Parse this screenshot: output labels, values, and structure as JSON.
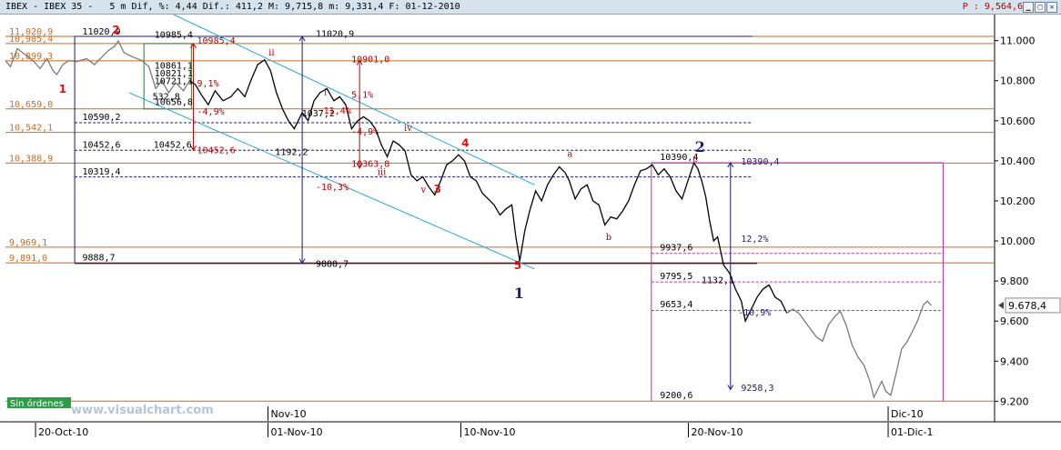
{
  "title_bar": {
    "text": "IBEX - IBEX 35 -   5 m Dif, %: 4,44 Dif.: 411,2 M: 9,715,8 m: 9,331,4 F: 01-12-2010",
    "close_text": "P : 9,564,6",
    "buttons": [
      "minimize",
      "maximize",
      "close"
    ]
  },
  "colors": {
    "background": "#ffffff",
    "price_dark": "#000000",
    "price_light": "#7a7a7a",
    "horizontal_level": "#d2691e",
    "channel": "#2aa8d8",
    "navy": "#1c1c7a",
    "magenta": "#c030a0",
    "red": "#c00000",
    "green_box": "#2e7d32",
    "watermark": "#b8c4d8"
  },
  "chart_data": {
    "type": "line",
    "symbol": "IBEX 35",
    "interval": "5 m",
    "ylim": [
      9120,
      11130
    ],
    "y_ticks": [
      "11.000",
      "10.800",
      "10.600",
      "10.400",
      "10.200",
      "10.000",
      "9.800",
      "9.600",
      "9.400",
      "9.200"
    ],
    "last_price": "9.678,4",
    "x_labels": [
      {
        "label": "20-Oct-10",
        "pos": 0.035
      },
      {
        "label": "Nov-10",
        "pos": 0.27,
        "tier": "month"
      },
      {
        "label": "01-Nov-10",
        "pos": 0.27
      },
      {
        "label": "10-Nov-10",
        "pos": 0.465
      },
      {
        "label": "20-Nov-10",
        "pos": 0.695
      },
      {
        "label": "Dic-10",
        "pos": 0.897,
        "tier": "month"
      },
      {
        "label": "01-Dic-1",
        "pos": 0.897
      }
    ],
    "price_series": [
      [
        0.0,
        10900
      ],
      [
        0.005,
        10870
      ],
      [
        0.012,
        10960
      ],
      [
        0.02,
        10930
      ],
      [
        0.028,
        10900
      ],
      [
        0.035,
        10860
      ],
      [
        0.042,
        10910
      ],
      [
        0.048,
        10850
      ],
      [
        0.052,
        10830
      ],
      [
        0.058,
        10880
      ],
      [
        0.064,
        10900
      ],
      [
        0.072,
        10895
      ],
      [
        0.082,
        10910
      ],
      [
        0.09,
        10880
      ],
      [
        0.098,
        10920
      ],
      [
        0.104,
        10950
      ],
      [
        0.11,
        10970
      ],
      [
        0.114,
        10998
      ],
      [
        0.12,
        10940
      ],
      [
        0.128,
        10920
      ],
      [
        0.138,
        10900
      ],
      [
        0.145,
        10870
      ],
      [
        0.152,
        10760
      ],
      [
        0.158,
        10800
      ],
      [
        0.165,
        10740
      ],
      [
        0.172,
        10790
      ],
      [
        0.18,
        10750
      ],
      [
        0.186,
        10800
      ],
      [
        0.192,
        10780
      ],
      [
        0.198,
        10730
      ],
      [
        0.205,
        10680
      ],
      [
        0.212,
        10750
      ],
      [
        0.22,
        10700
      ],
      [
        0.228,
        10720
      ],
      [
        0.235,
        10760
      ],
      [
        0.242,
        10720
      ],
      [
        0.248,
        10800
      ],
      [
        0.255,
        10880
      ],
      [
        0.262,
        10904
      ],
      [
        0.268,
        10850
      ],
      [
        0.274,
        10740
      ],
      [
        0.28,
        10660
      ],
      [
        0.286,
        10600
      ],
      [
        0.292,
        10560
      ],
      [
        0.3,
        10640
      ],
      [
        0.306,
        10600
      ],
      [
        0.312,
        10700
      ],
      [
        0.318,
        10740
      ],
      [
        0.325,
        10760
      ],
      [
        0.332,
        10700
      ],
      [
        0.338,
        10720
      ],
      [
        0.344,
        10680
      ],
      [
        0.35,
        10560
      ],
      [
        0.356,
        10600
      ],
      [
        0.362,
        10620
      ],
      [
        0.368,
        10600
      ],
      [
        0.374,
        10560
      ],
      [
        0.38,
        10480
      ],
      [
        0.386,
        10420
      ],
      [
        0.392,
        10500
      ],
      [
        0.398,
        10480
      ],
      [
        0.404,
        10450
      ],
      [
        0.41,
        10330
      ],
      [
        0.416,
        10300
      ],
      [
        0.422,
        10320
      ],
      [
        0.428,
        10270
      ],
      [
        0.434,
        10230
      ],
      [
        0.44,
        10300
      ],
      [
        0.446,
        10380
      ],
      [
        0.452,
        10400
      ],
      [
        0.458,
        10430
      ],
      [
        0.464,
        10400
      ],
      [
        0.47,
        10320
      ],
      [
        0.476,
        10300
      ],
      [
        0.482,
        10240
      ],
      [
        0.488,
        10210
      ],
      [
        0.494,
        10180
      ],
      [
        0.5,
        10130
      ],
      [
        0.506,
        10160
      ],
      [
        0.512,
        10180
      ],
      [
        0.516,
        10020
      ],
      [
        0.52,
        9900
      ],
      [
        0.525,
        10050
      ],
      [
        0.53,
        10150
      ],
      [
        0.536,
        10250
      ],
      [
        0.542,
        10200
      ],
      [
        0.548,
        10280
      ],
      [
        0.554,
        10330
      ],
      [
        0.56,
        10370
      ],
      [
        0.566,
        10340
      ],
      [
        0.57,
        10300
      ],
      [
        0.576,
        10210
      ],
      [
        0.582,
        10260
      ],
      [
        0.588,
        10280
      ],
      [
        0.594,
        10200
      ],
      [
        0.6,
        10180
      ],
      [
        0.606,
        10080
      ],
      [
        0.612,
        10120
      ],
      [
        0.618,
        10110
      ],
      [
        0.624,
        10150
      ],
      [
        0.63,
        10200
      ],
      [
        0.636,
        10280
      ],
      [
        0.642,
        10350
      ],
      [
        0.648,
        10360
      ],
      [
        0.654,
        10380
      ],
      [
        0.66,
        10330
      ],
      [
        0.666,
        10360
      ],
      [
        0.672,
        10320
      ],
      [
        0.678,
        10250
      ],
      [
        0.684,
        10210
      ],
      [
        0.69,
        10300
      ],
      [
        0.696,
        10390
      ],
      [
        0.7,
        10360
      ],
      [
        0.704,
        10300
      ],
      [
        0.708,
        10220
      ],
      [
        0.712,
        10100
      ],
      [
        0.716,
        10000
      ],
      [
        0.72,
        10020
      ],
      [
        0.726,
        9880
      ],
      [
        0.732,
        9840
      ],
      [
        0.738,
        9760
      ],
      [
        0.744,
        9700
      ],
      [
        0.748,
        9600
      ],
      [
        0.754,
        9660
      ],
      [
        0.76,
        9720
      ],
      [
        0.766,
        9760
      ],
      [
        0.772,
        9780
      ],
      [
        0.778,
        9720
      ],
      [
        0.784,
        9700
      ],
      [
        0.79,
        9640
      ],
      [
        0.796,
        9660
      ],
      [
        0.802,
        9640
      ],
      [
        0.808,
        9600
      ],
      [
        0.814,
        9560
      ],
      [
        0.82,
        9520
      ],
      [
        0.826,
        9500
      ],
      [
        0.832,
        9580
      ],
      [
        0.838,
        9620
      ],
      [
        0.844,
        9650
      ],
      [
        0.85,
        9580
      ],
      [
        0.856,
        9480
      ],
      [
        0.862,
        9420
      ],
      [
        0.868,
        9380
      ],
      [
        0.874,
        9300
      ],
      [
        0.878,
        9220
      ],
      [
        0.882,
        9260
      ],
      [
        0.886,
        9300
      ],
      [
        0.89,
        9250
      ],
      [
        0.895,
        9230
      ],
      [
        0.9,
        9330
      ],
      [
        0.906,
        9460
      ],
      [
        0.912,
        9500
      ],
      [
        0.918,
        9560
      ],
      [
        0.922,
        9600
      ],
      [
        0.928,
        9680
      ],
      [
        0.932,
        9700
      ],
      [
        0.936,
        9678
      ]
    ],
    "horizontal_levels": [
      {
        "label": "11,020,9",
        "value": 11020.9
      },
      {
        "label": "10,985,4",
        "value": 10985.4
      },
      {
        "label": "10,899,3",
        "value": 10899.3
      },
      {
        "label": "10,659,0",
        "value": 10659.0
      },
      {
        "label": "10,542,1",
        "value": 10542.1
      },
      {
        "label": "10,388,9",
        "value": 10388.9
      },
      {
        "label": "9,969,1",
        "value": 9969.1
      },
      {
        "label": "9,891,0",
        "value": 9891.0
      },
      {
        "label": "",
        "value": 9200.6
      }
    ],
    "dotted_levels": [
      {
        "label": "10590,2",
        "value": 10590.2
      },
      {
        "label": "10452,6",
        "value": 10452.6
      },
      {
        "label": "10319,4",
        "value": 10319.4
      },
      {
        "label": "9937,6",
        "value": 9937.6
      },
      {
        "label": "9795,5",
        "value": 9795.5
      },
      {
        "label": "9653,4",
        "value": 9653.4
      }
    ],
    "annotations": [
      {
        "text": "11020,9",
        "x": 0.074,
        "value": 11030
      },
      {
        "text": "10985,4",
        "x": 0.147,
        "value": 11015
      },
      {
        "text": "10985,4",
        "x": 0.19,
        "value": 10985
      },
      {
        "text": "10861,1",
        "x": 0.147,
        "value": 10860
      },
      {
        "text": "10821,1",
        "x": 0.147,
        "value": 10822
      },
      {
        "text": "10721,1",
        "x": 0.147,
        "value": 10782
      },
      {
        "text": "532,8",
        "x": 0.145,
        "value": 10706
      },
      {
        "text": "10656,8",
        "x": 0.147,
        "value": 10679
      },
      {
        "text": "9,1%",
        "x": 0.19,
        "value": 10772
      },
      {
        "text": "-4,9%",
        "x": 0.19,
        "value": 10632
      },
      {
        "text": "10590,2",
        "x": 0.074,
        "value": 10603
      },
      {
        "text": "10452,6",
        "x": 0.074,
        "value": 10465
      },
      {
        "text": "10452,6",
        "x": 0.146,
        "value": 10465
      },
      {
        "text": "10452,6",
        "x": 0.19,
        "value": 10438
      },
      {
        "text": "1192,2",
        "x": 0.269,
        "value": 10430
      },
      {
        "text": "10319,4",
        "x": 0.074,
        "value": 10332
      },
      {
        "text": "11020,9",
        "x": 0.31,
        "value": 11018
      },
      {
        "text": "9888,7",
        "x": 0.31,
        "value": 9872
      },
      {
        "text": "-10,3%",
        "x": 0.31,
        "value": 10255
      },
      {
        "text": "9888,7",
        "x": 0.074,
        "value": 9902
      },
      {
        "text": "10901,0",
        "x": 0.346,
        "value": 10892
      },
      {
        "text": "10363,8",
        "x": 0.346,
        "value": 10370
      },
      {
        "text": "5,1%",
        "x": 0.346,
        "value": 10715
      },
      {
        "text": "-4,9%",
        "x": 0.346,
        "value": 10530
      },
      {
        "text": "1037,2",
        "x": 0.296,
        "value": 10622
      },
      {
        "text": "11,4%",
        "x": 0.318,
        "value": 10636
      },
      {
        "text": "10390,4",
        "x": 0.658,
        "value": 10405
      },
      {
        "text": "10390,4",
        "x": 0.74,
        "value": 10382
      },
      {
        "text": "12,2%",
        "x": 0.74,
        "value": 9995
      },
      {
        "text": "9937,6",
        "x": 0.658,
        "value": 9952
      },
      {
        "text": "9795,5",
        "x": 0.658,
        "value": 9810
      },
      {
        "text": "1132,1",
        "x": 0.7,
        "value": 9790
      },
      {
        "text": "9653,4",
        "x": 0.658,
        "value": 9668
      },
      {
        "text": "-10,9%",
        "x": 0.737,
        "value": 9628
      },
      {
        "text": "9258,3",
        "x": 0.74,
        "value": 9252
      },
      {
        "text": "9200,6",
        "x": 0.658,
        "value": 9215
      }
    ],
    "wave_labels": [
      {
        "text": "1",
        "x": 0.054,
        "value": 10740,
        "style": "red-bold"
      },
      {
        "text": "2",
        "x": 0.108,
        "value": 11035,
        "style": "red-bold"
      },
      {
        "text": "3",
        "x": 0.433,
        "value": 10240,
        "style": "red-bold"
      },
      {
        "text": "4",
        "x": 0.461,
        "value": 10470,
        "style": "red-bold"
      },
      {
        "text": "5",
        "x": 0.514,
        "value": 9860,
        "style": "red-bold"
      },
      {
        "text": "1",
        "x": 0.514,
        "value": 9715,
        "style": "navy-bold"
      },
      {
        "text": "2",
        "x": 0.697,
        "value": 10445,
        "style": "navy-bold"
      },
      {
        "text": "i",
        "x": 0.322,
        "value": 10728,
        "style": "red-small"
      },
      {
        "text": "ii",
        "x": 0.266,
        "value": 10925,
        "style": "red-small"
      },
      {
        "text": "iii",
        "x": 0.376,
        "value": 10330,
        "style": "red-small"
      },
      {
        "text": "iv",
        "x": 0.403,
        "value": 10550,
        "style": "red-small"
      },
      {
        "text": "v",
        "x": 0.42,
        "value": 10240,
        "style": "red-small"
      },
      {
        "text": "a",
        "x": 0.568,
        "value": 10420,
        "style": "red-small"
      },
      {
        "text": "b",
        "x": 0.607,
        "value": 10005,
        "style": "red-small"
      },
      {
        "text": "c",
        "x": 0.695,
        "value": 10395,
        "style": "red-small"
      }
    ],
    "channel_lines": [
      {
        "x1": 0.17,
        "v1": 11130,
        "x2": 0.535,
        "v2": 10280
      },
      {
        "x1": 0.125,
        "v1": 10740,
        "x2": 0.535,
        "v2": 9860
      }
    ]
  },
  "status_badge": "Sin órdenes",
  "watermark": "www.visualchart.com"
}
